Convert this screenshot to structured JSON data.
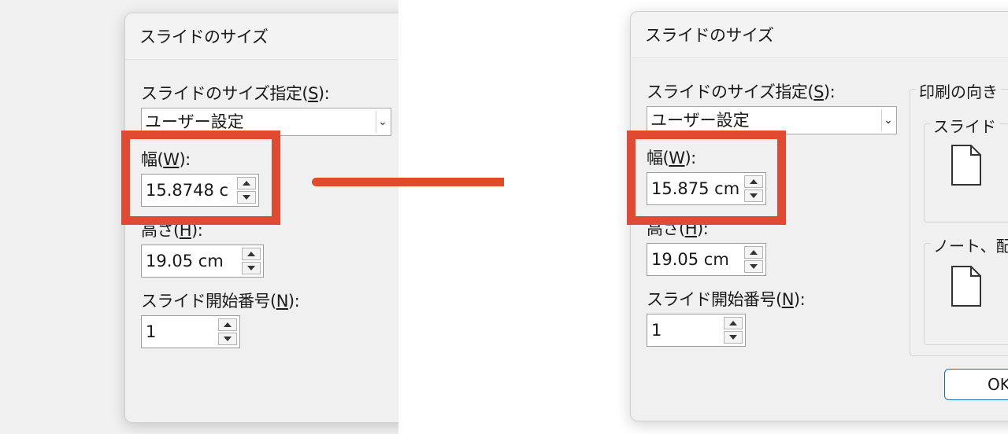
{
  "dialog": {
    "title": "スライドのサイズ",
    "size_label": "スライドのサイズ指定(",
    "size_key": "S",
    "size_label_end": "):",
    "size_value": "ユーザー設定",
    "width_label": "幅(",
    "width_key": "W",
    "width_label_end": "):",
    "height_label": "高さ(",
    "height_key": "H",
    "height_label_end": "):",
    "height_value": "19.05 cm",
    "start_label": "スライド開始番号(",
    "start_key": "N",
    "start_label_end": "):",
    "start_value": "1"
  },
  "before": {
    "width_value": "15.8748 c"
  },
  "after": {
    "width_value": "15.875 cm",
    "orientation_label": "印刷の向き",
    "slides_group": "スライド",
    "notes_group": "ノート、配",
    "ok_label": "OK"
  },
  "colors": {
    "highlight": "#e04a32",
    "accent": "#0f6cbd"
  }
}
